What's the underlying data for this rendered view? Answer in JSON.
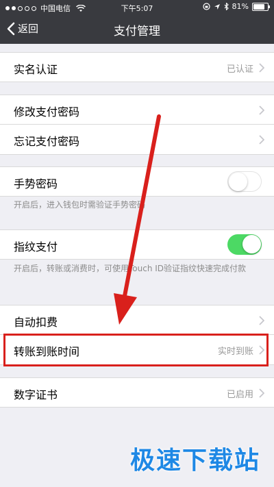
{
  "status_bar": {
    "carrier": "中国电信",
    "time": "下午5:07",
    "battery": "81%",
    "battery_level": 0.81
  },
  "nav": {
    "back_label": "返回",
    "title": "支付管理"
  },
  "items": {
    "real_name": {
      "label": "实名认证",
      "value": "已认证"
    },
    "change_password": {
      "label": "修改支付密码"
    },
    "forgot_password": {
      "label": "忘记支付密码"
    },
    "gesture_password": {
      "label": "手势密码",
      "enabled": false,
      "hint": "开启后，进入钱包时需验证手势密码"
    },
    "fingerprint": {
      "label": "指纹支付",
      "enabled": true,
      "hint": "开启后，转账或消费时，可使用Touch ID验证指纹快速完成付款"
    },
    "auto_deduct": {
      "label": "自动扣费"
    },
    "transfer_time": {
      "label": "转账到账时间",
      "value": "实时到账"
    },
    "digital_cert": {
      "label": "数字证书",
      "value": "已启用"
    }
  },
  "colors": {
    "nav_bg": "#393a3f",
    "toggle_on": "#4cd964",
    "annotation_red": "#d9201c",
    "watermark_blue": "#1e88e5"
  },
  "watermark": "极速下载站"
}
